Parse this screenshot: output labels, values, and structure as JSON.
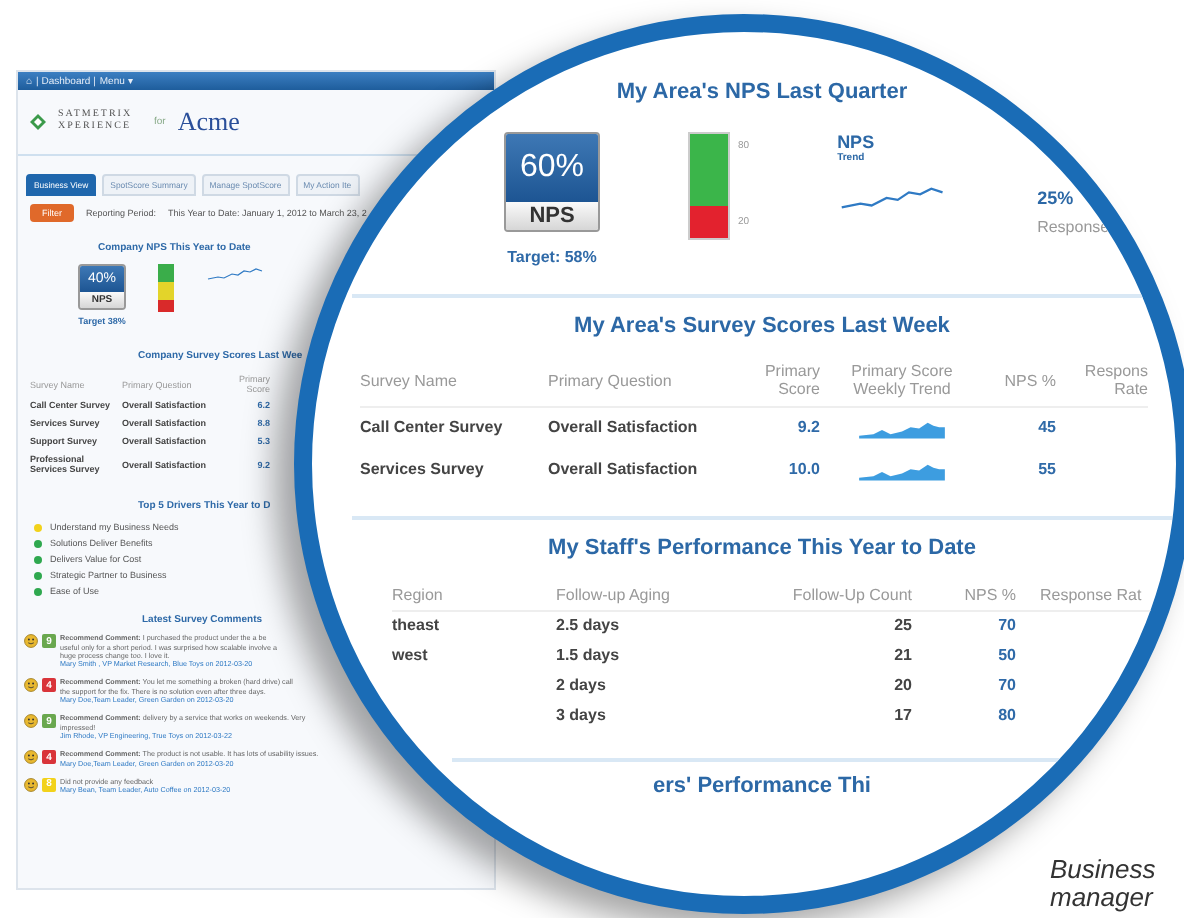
{
  "dashboard": {
    "nav": [
      "⌂",
      "| Dashboard |",
      "Menu ▾"
    ],
    "logo": {
      "brand": "SATMETRIX XPERIENCE",
      "joiner": "for",
      "client": "Acme"
    },
    "tabs": [
      {
        "label": "Business View",
        "selected": true
      },
      {
        "label": "SpotScore Summary",
        "selected": false
      },
      {
        "label": "Manage SpotScore",
        "selected": false
      },
      {
        "label": "My Action Ite",
        "selected": false
      }
    ],
    "filter": {
      "button": "Filter",
      "label": "Reporting Period:",
      "value": "This Year to Date: January 1, 2012 to March 23, 2"
    },
    "nps": {
      "title": "Company NPS This Year to Date",
      "score": "40%",
      "label": "NPS",
      "target": "Target 38%"
    },
    "survey_table": {
      "title": "Company Survey Scores Last Wee",
      "columns": [
        "Survey Name",
        "Primary Question",
        "Primary Score"
      ],
      "rows": [
        [
          "Call Center Survey",
          "Overall Satisfaction",
          "6.2"
        ],
        [
          "Services Survey",
          "Overall Satisfaction",
          "8.8"
        ],
        [
          "Support Survey",
          "Overall Satisfaction",
          "5.3"
        ],
        [
          "Professional Services Survey",
          "Overall Satisfaction",
          "9.2"
        ]
      ]
    },
    "drivers": {
      "title": "Top 5 Drivers This Year to D",
      "items": [
        {
          "label": "Understand my Business Needs",
          "color": "#f2d21b"
        },
        {
          "label": "Solutions Deliver Benefits",
          "color": "#2fa84f"
        },
        {
          "label": "Delivers Value for Cost",
          "color": "#2fa84f"
        },
        {
          "label": "Strategic Partner to Business",
          "color": "#2fa84f"
        },
        {
          "label": "Ease of Use",
          "color": "#2fa84f"
        }
      ]
    },
    "comments": {
      "title": "Latest Survey Comments",
      "items": [
        {
          "score": "9",
          "color": "#6aa84f",
          "text": "**Recommend Comment:** I purchased the product under the a be useful only for a short period. I was surprised how scalable involve a huge process change too. I love it.",
          "author": "Mary Smith , VP Market Research, Blue Toys on 2012-03-20"
        },
        {
          "score": "4",
          "color": "#d9343a",
          "text": "**Recommend Comment:** You let me something a broken (hard drive) call the support for the fix. There is no solution even after three days.",
          "author": "Mary Doe,Team Leader, Green Garden on 2012-03-20"
        },
        {
          "score": "9",
          "color": "#6aa84f",
          "text": "**Recommend Comment:** delivery by a service that works on weekends. Very impressed!",
          "author": "Jim Rhode, VP Engineering, True Toys on 2012-03-22"
        },
        {
          "score": "4",
          "color": "#d9343a",
          "text": "**Recommend Comment:** The product is not usable. It has lots of usability issues.",
          "author": "Mary Doe,Team Leader, Green Garden on 2012-03-20"
        },
        {
          "score": "8",
          "color": "#f2d21b",
          "text": "Did not provide any feedback",
          "author": "Mary Bean, Team Leader, Auto Coffee on 2012-03-20"
        }
      ]
    }
  },
  "magnifier": {
    "nps": {
      "title": "My Area's NPS Last Quarter",
      "score": "60%",
      "label": "NPS",
      "target": "Target: 58%",
      "gauge": {
        "high": "80",
        "low": "20",
        "level": 0.3
      },
      "trend": {
        "title": "NPS",
        "subtitle": "Trend"
      },
      "responses": {
        "value": "25%",
        "label": "Response"
      }
    },
    "survey_table": {
      "title": "My Area's Survey Scores Last Week",
      "columns": [
        "Survey Name",
        "Primary Question",
        "Primary Score",
        "Primary Score Weekly Trend",
        "NPS %",
        "Respons Rate"
      ],
      "rows": [
        {
          "name": "Call Center Survey",
          "question": "Overall Satisfaction",
          "score": "9.2",
          "nps": "45"
        },
        {
          "name": "Services Survey",
          "question": "Overall Satisfaction",
          "score": "10.0",
          "nps": "55"
        }
      ]
    },
    "staff_table": {
      "title": "My Staff's Performance This Year to Date",
      "columns": [
        "Region",
        "Follow-up Aging",
        "Follow-Up Count",
        "NPS %",
        "Response Rat"
      ],
      "rows": [
        {
          "region": "theast",
          "aging": "2.5 days",
          "count": "25",
          "nps": "70"
        },
        {
          "region": "west",
          "aging": "1.5 days",
          "count": "21",
          "nps": "50"
        },
        {
          "aging": "2 days",
          "count": "20",
          "nps": "70"
        },
        {
          "aging": "3 days",
          "count": "17",
          "nps": "80"
        }
      ]
    },
    "next_title": "ers' Performance Thi"
  },
  "caption": [
    "Business",
    "manager"
  ]
}
